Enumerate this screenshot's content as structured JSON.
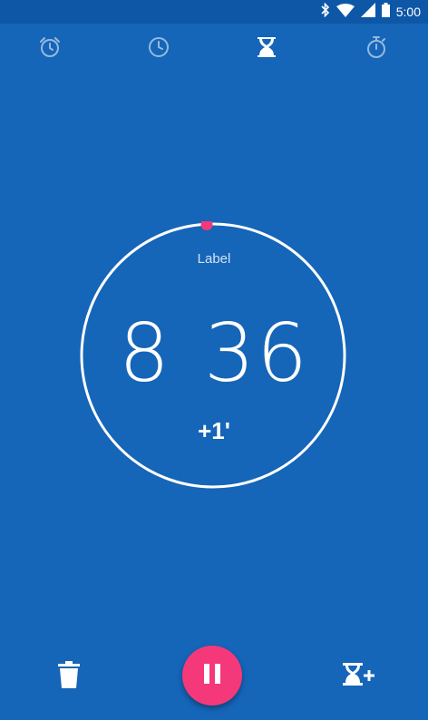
{
  "status_bar": {
    "time": "5:00",
    "icons": [
      "bluetooth-icon",
      "wifi-icon",
      "signal-icon",
      "battery-icon"
    ]
  },
  "tabs": [
    {
      "name": "alarm",
      "icon": "alarm-clock-icon",
      "active": false
    },
    {
      "name": "clock",
      "icon": "clock-icon",
      "active": false
    },
    {
      "name": "timer",
      "icon": "hourglass-icon",
      "active": true
    },
    {
      "name": "stopwatch",
      "icon": "stopwatch-icon",
      "active": false
    }
  ],
  "timer": {
    "label": "Label",
    "time": "8 36",
    "add_minute": "+1'",
    "progress_indicator_color": "#F5387A",
    "ring_color": "#FFFFFF"
  },
  "controls": {
    "delete_icon": "trash-icon",
    "pause_icon": "pause-icon",
    "add_timer_icon": "add-timer-icon",
    "fab_color": "#F5387A"
  },
  "colors": {
    "background": "#1565B8",
    "status_bar": "#0D57A6"
  }
}
